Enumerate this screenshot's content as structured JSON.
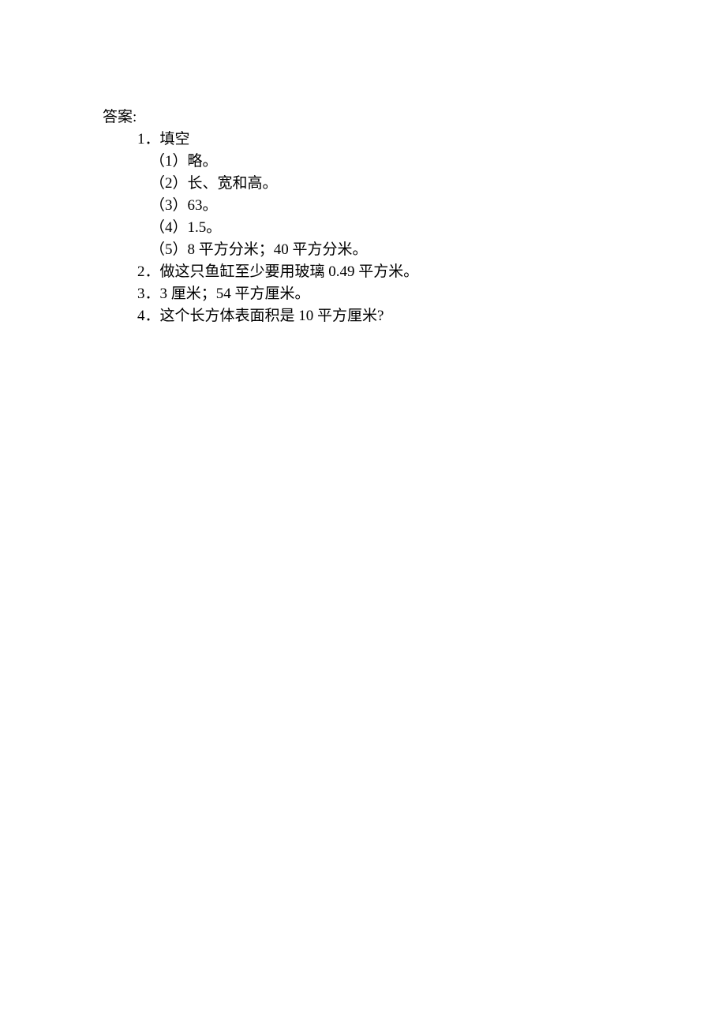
{
  "heading": "答案:",
  "section1": {
    "title": "1．填空",
    "items": [
      "（1）略。",
      "（2）长、宽和高。",
      "（3）63。",
      "（4）1.5。",
      "（5）8 平方分米；40 平方分米。"
    ]
  },
  "lines": [
    "2．做这只鱼缸至少要用玻璃 0.49 平方米。",
    "3．3 厘米；54 平方厘米。",
    "4．这个长方体表面积是 10 平方厘米?"
  ]
}
